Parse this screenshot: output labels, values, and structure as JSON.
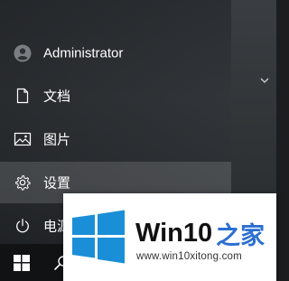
{
  "start_menu": {
    "user": {
      "label": "Administrator",
      "icon": "user-icon"
    },
    "items": [
      {
        "label": "文档",
        "icon": "document-icon"
      },
      {
        "label": "图片",
        "icon": "pictures-icon"
      },
      {
        "label": "设置",
        "icon": "gear-icon",
        "active": true
      },
      {
        "label": "电源",
        "icon": "power-icon"
      }
    ],
    "expand_icon": "chevron-down-icon"
  },
  "taskbar": {
    "start_icon": "windows-logo-icon",
    "search_icon": "search-icon"
  },
  "watermark": {
    "title_prefix": "Win10",
    "title_suffix": "之家",
    "url": "www.win10xitong.com",
    "logo": "windows-logo",
    "colors": {
      "logo_blue": "#1a8fd8",
      "text_blue": "#2b6fd1"
    }
  }
}
